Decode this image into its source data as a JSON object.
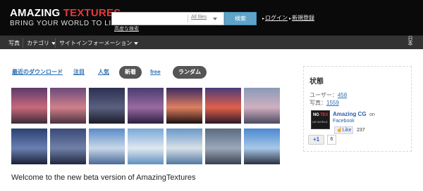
{
  "header": {
    "logo_main_a": "AMAZING ",
    "logo_main_b": "TEXTURES",
    "logo_tagline": "BRING YOUR WORLD TO LIFE",
    "search_placeholder": "",
    "search_scope": "All files",
    "search_button": "検索",
    "advanced_search": "高度な検索",
    "login": "ログイン",
    "register": "新規登録",
    "link_arrow": "▸",
    "accent_color": "#e23a3a"
  },
  "nav": {
    "items": [
      "写真",
      "カテゴリ",
      "サイトインフォーメーション"
    ],
    "vertical_label": "日本"
  },
  "tabs": [
    "最近のダウンロード",
    "注目",
    "人気",
    "新着",
    "free",
    "ランダム"
  ],
  "thumbnails": [
    {
      "name": "sunset-sky-1",
      "top": "#5c3a6b",
      "mid": "#c8697a",
      "bottom": "#3a2a3a"
    },
    {
      "name": "sunset-sky-2",
      "top": "#6a4a7a",
      "mid": "#d0808a",
      "bottom": "#4a3040"
    },
    {
      "name": "dusk-sky-1",
      "top": "#2c3050",
      "mid": "#5a6080",
      "bottom": "#1a1c28"
    },
    {
      "name": "purple-dusk-1",
      "top": "#4a3c70",
      "mid": "#9a6aa0",
      "bottom": "#2a2040"
    },
    {
      "name": "sunset-silhouette-1",
      "top": "#3a2a60",
      "mid": "#e08060",
      "bottom": "#1a1010"
    },
    {
      "name": "sunset-horizon-1",
      "top": "#4a3a7a",
      "mid": "#e0604a",
      "bottom": "#2a1828"
    },
    {
      "name": "pastel-dusk-1",
      "top": "#8a9ab8",
      "mid": "#d0b0c0",
      "bottom": "#4a4a60"
    },
    {
      "name": "blue-dusk-1",
      "top": "#2a4070",
      "mid": "#6a80b0",
      "bottom": "#1a2038"
    },
    {
      "name": "blue-dusk-2",
      "top": "#3a4a78",
      "mid": "#7080a8",
      "bottom": "#202840"
    },
    {
      "name": "cloud-sky-1",
      "top": "#5a8ac8",
      "mid": "#c8d8e8",
      "bottom": "#4a6a98"
    },
    {
      "name": "cloud-sky-2",
      "top": "#7aa8d8",
      "mid": "#e0e8f0",
      "bottom": "#6090c0"
    },
    {
      "name": "cloud-sky-3",
      "top": "#6898c8",
      "mid": "#d8e0e8",
      "bottom": "#5078a0"
    },
    {
      "name": "grey-clouds-1",
      "top": "#5a6a80",
      "mid": "#9aa8b8",
      "bottom": "#3a4050"
    },
    {
      "name": "clear-sky-1",
      "top": "#4a88d0",
      "mid": "#a8c8e8",
      "bottom": "#2a3040"
    }
  ],
  "welcome": "Welcome to the new beta version of AmazingTextures",
  "panel": {
    "title": "状態",
    "users_label": "ユーザー：",
    "users_value": "458",
    "photos_label": "写真：",
    "photos_value": "1559",
    "fb_name": "Amazing CG",
    "fb_on": "on",
    "fb_site": "Facebook",
    "fb_img_a": "NG ",
    "fb_img_b": "TEX",
    "fb_img_tag": "UR WORLD",
    "like_label": "Like",
    "like_count": "237",
    "gplus_label": "+1",
    "gplus_count": "6"
  }
}
